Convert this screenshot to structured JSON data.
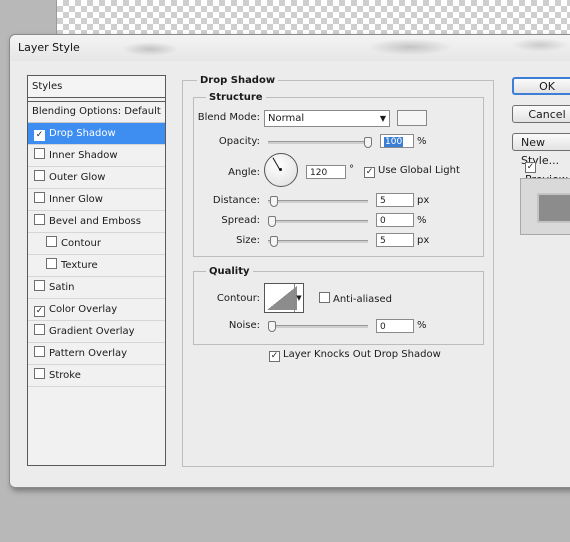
{
  "dialog": {
    "title": "Layer Style"
  },
  "styles_list": {
    "header": "Styles",
    "blending_options": "Blending Options: Default",
    "items": [
      {
        "label": "Drop Shadow",
        "checked": true,
        "selected": true,
        "indent": false
      },
      {
        "label": "Inner Shadow",
        "checked": false,
        "selected": false,
        "indent": false
      },
      {
        "label": "Outer Glow",
        "checked": false,
        "selected": false,
        "indent": false
      },
      {
        "label": "Inner Glow",
        "checked": false,
        "selected": false,
        "indent": false
      },
      {
        "label": "Bevel and Emboss",
        "checked": false,
        "selected": false,
        "indent": false
      },
      {
        "label": "Contour",
        "checked": false,
        "selected": false,
        "indent": true
      },
      {
        "label": "Texture",
        "checked": false,
        "selected": false,
        "indent": true
      },
      {
        "label": "Satin",
        "checked": false,
        "selected": false,
        "indent": false
      },
      {
        "label": "Color Overlay",
        "checked": true,
        "selected": false,
        "indent": false
      },
      {
        "label": "Gradient Overlay",
        "checked": false,
        "selected": false,
        "indent": false
      },
      {
        "label": "Pattern Overlay",
        "checked": false,
        "selected": false,
        "indent": false
      },
      {
        "label": "Stroke",
        "checked": false,
        "selected": false,
        "indent": false
      }
    ]
  },
  "drop_shadow": {
    "title": "Drop Shadow",
    "structure": {
      "title": "Structure",
      "blend_mode_label": "Blend Mode:",
      "blend_mode_value": "Normal",
      "opacity_label": "Opacity:",
      "opacity_value": "100",
      "opacity_unit": "%",
      "opacity_fraction": 1.0,
      "angle_label": "Angle:",
      "angle_value": "120",
      "angle_unit": "°",
      "use_global_light_label": "Use Global Light",
      "use_global_light_checked": true,
      "distance_label": "Distance:",
      "distance_value": "5",
      "distance_unit": "px",
      "spread_label": "Spread:",
      "spread_value": "0",
      "spread_unit": "%",
      "size_label": "Size:",
      "size_value": "5",
      "size_unit": "px"
    },
    "quality": {
      "title": "Quality",
      "contour_label": "Contour:",
      "anti_aliased_label": "Anti-aliased",
      "anti_aliased_checked": false,
      "noise_label": "Noise:",
      "noise_value": "0",
      "noise_unit": "%"
    },
    "knockout_label": "Layer Knocks Out Drop Shadow",
    "knockout_checked": true
  },
  "buttons": {
    "ok": "OK",
    "cancel": "Cancel",
    "new_style": "New Style...",
    "preview_label": "Preview",
    "preview_checked": true
  },
  "colors": {
    "selection": "#3d8ef0",
    "default_button_border": "#3d7ed6"
  }
}
